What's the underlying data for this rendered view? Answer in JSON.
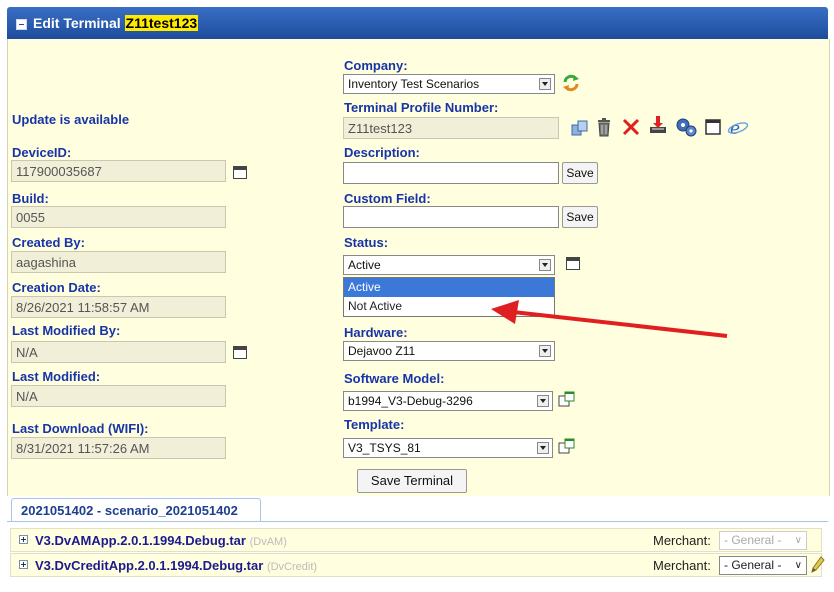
{
  "title": {
    "prefix": "Edit Terminal",
    "name": "Z11test123"
  },
  "left": {
    "update_notice": "Update is available",
    "device_id": {
      "label": "DeviceID:",
      "value": "117900035687"
    },
    "build": {
      "label": "Build:",
      "value": "0055"
    },
    "created_by": {
      "label": "Created By:",
      "value": "aagashina"
    },
    "creation_date": {
      "label": "Creation Date:",
      "value": "8/26/2021 11:58:57 AM"
    },
    "last_modified_by": {
      "label": "Last Modified By:",
      "value": "N/A"
    },
    "last_modified": {
      "label": "Last Modified:",
      "value": "N/A"
    },
    "last_download": {
      "label": "Last Download (WIFI):",
      "value": "8/31/2021 11:57:26 AM"
    }
  },
  "right": {
    "company": {
      "label": "Company:",
      "value": "Inventory Test Scenarios"
    },
    "profile_number": {
      "label": "Terminal Profile Number:",
      "value": "Z11test123"
    },
    "description": {
      "label": "Description:",
      "value": "",
      "save": "Save"
    },
    "custom_field": {
      "label": "Custom Field:",
      "value": "",
      "save": "Save"
    },
    "status": {
      "label": "Status:",
      "value": "Active",
      "options": [
        "Active",
        "Not Active"
      ]
    },
    "hardware": {
      "label": "Hardware:",
      "value": "Dejavoo Z11"
    },
    "software_model": {
      "label": "Software Model:",
      "value": "b1994_V3-Debug-3296"
    },
    "template": {
      "label": "Template:",
      "value": "V3_TSYS_81"
    }
  },
  "save_terminal": "Save Terminal",
  "tab_label": "2021051402 - scenario_2021051402",
  "packages": [
    {
      "name": "V3.DvAMApp.2.0.1.1994.Debug.tar",
      "tag": "(DvAM)",
      "merchant_label": "Merchant:",
      "merchant_value": "- General -",
      "enabled": false
    },
    {
      "name": "V3.DvCreditApp.2.0.1.1994.Debug.tar",
      "tag": "(DvCredit)",
      "merchant_label": "Merchant:",
      "merchant_value": "- General -",
      "enabled": true
    }
  ],
  "colors": {
    "title_bar": "#1e4c9c",
    "label_blue": "#1734a8",
    "form_bg": "#fffedf",
    "highlight": "#ffea00",
    "arrow": "#e02020",
    "dropdown_active": "#3c78d8"
  }
}
